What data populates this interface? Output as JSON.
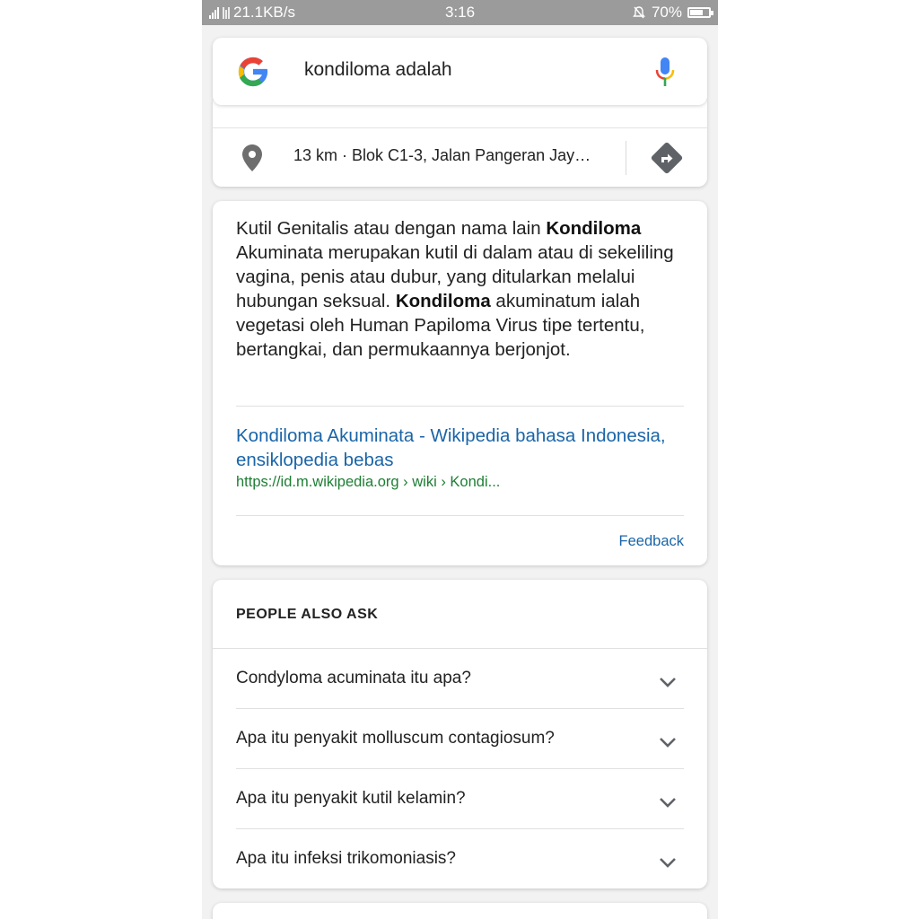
{
  "status_bar": {
    "network_speed": "21.1KB/s",
    "time": "3:16",
    "battery": "70%",
    "battery_level": 0.7
  },
  "search": {
    "query": "kondiloma adalah",
    "logo_icon": "google-g-icon",
    "mic_icon": "microphone-icon"
  },
  "map": {
    "pin_icon": "location-pin-icon",
    "address": "13 km · Blok C1-3, Jalan Pangeran Jay…",
    "directions_icon": "directions-icon"
  },
  "answer": {
    "segments": [
      {
        "text": "Kutil Genitalis atau dengan nama lain ",
        "bold": false
      },
      {
        "text": "Kondiloma",
        "bold": true
      },
      {
        "text": " Akuminata merupakan kutil di dalam atau di sekeliling vagina, penis atau dubur, yang ditularkan melalui hubungan seksual. ",
        "bold": false
      },
      {
        "text": "Kondiloma",
        "bold": true
      },
      {
        "text": " akuminatum ialah vegetasi oleh Human Papiloma Virus tipe tertentu, bertangkai, dan permukaannya berjonjot.",
        "bold": false
      }
    ],
    "source_title": "Kondiloma Akuminata - Wikipedia bahasa Indonesia, ensiklopedia bebas",
    "source_url": "https://id.m.wikipedia.org › wiki › Kondi...",
    "feedback_label": "Feedback"
  },
  "people_also_ask": {
    "title": "PEOPLE ALSO ASK",
    "questions": [
      "Condyloma acuminata itu apa?",
      "Apa itu penyakit molluscum contagiosum?",
      "Apa itu penyakit kutil kelamin?",
      "Apa itu infeksi trikomoniasis?"
    ],
    "expand_icon": "chevron-down-icon"
  },
  "colors": {
    "link": "#1a65a8",
    "url": "#1e7e34",
    "status_bar": "#9b9b9b"
  }
}
